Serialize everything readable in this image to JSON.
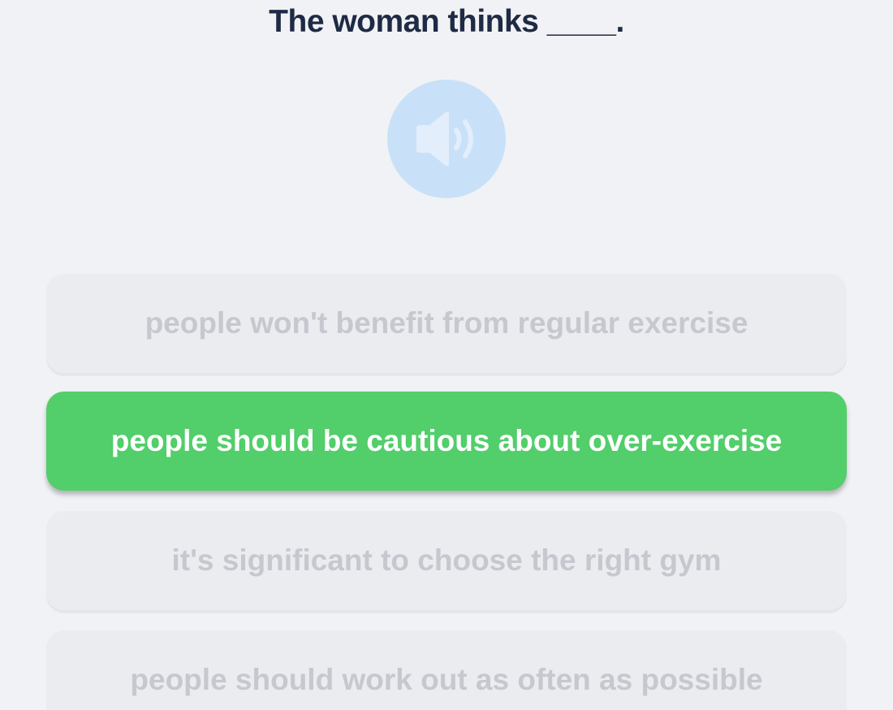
{
  "question": {
    "text": "The woman thinks ____."
  },
  "audio": {
    "icon": "speaker-volume-icon",
    "color": "#c8e1f8"
  },
  "options": [
    {
      "label": "people won't benefit from regular exercise",
      "selected": false
    },
    {
      "label": "people should be cautious about over-exercise",
      "selected": true
    },
    {
      "label": "it's significant to choose the right gym",
      "selected": false
    },
    {
      "label": "people should work out as often as possible",
      "selected": false
    }
  ],
  "colors": {
    "background": "#f1f2f5",
    "question_text": "#1f2a44",
    "option_bg": "#ebecf0",
    "option_text": "#c6c8cf",
    "selected_bg": "#52ce6a",
    "selected_text": "#ffffff"
  }
}
